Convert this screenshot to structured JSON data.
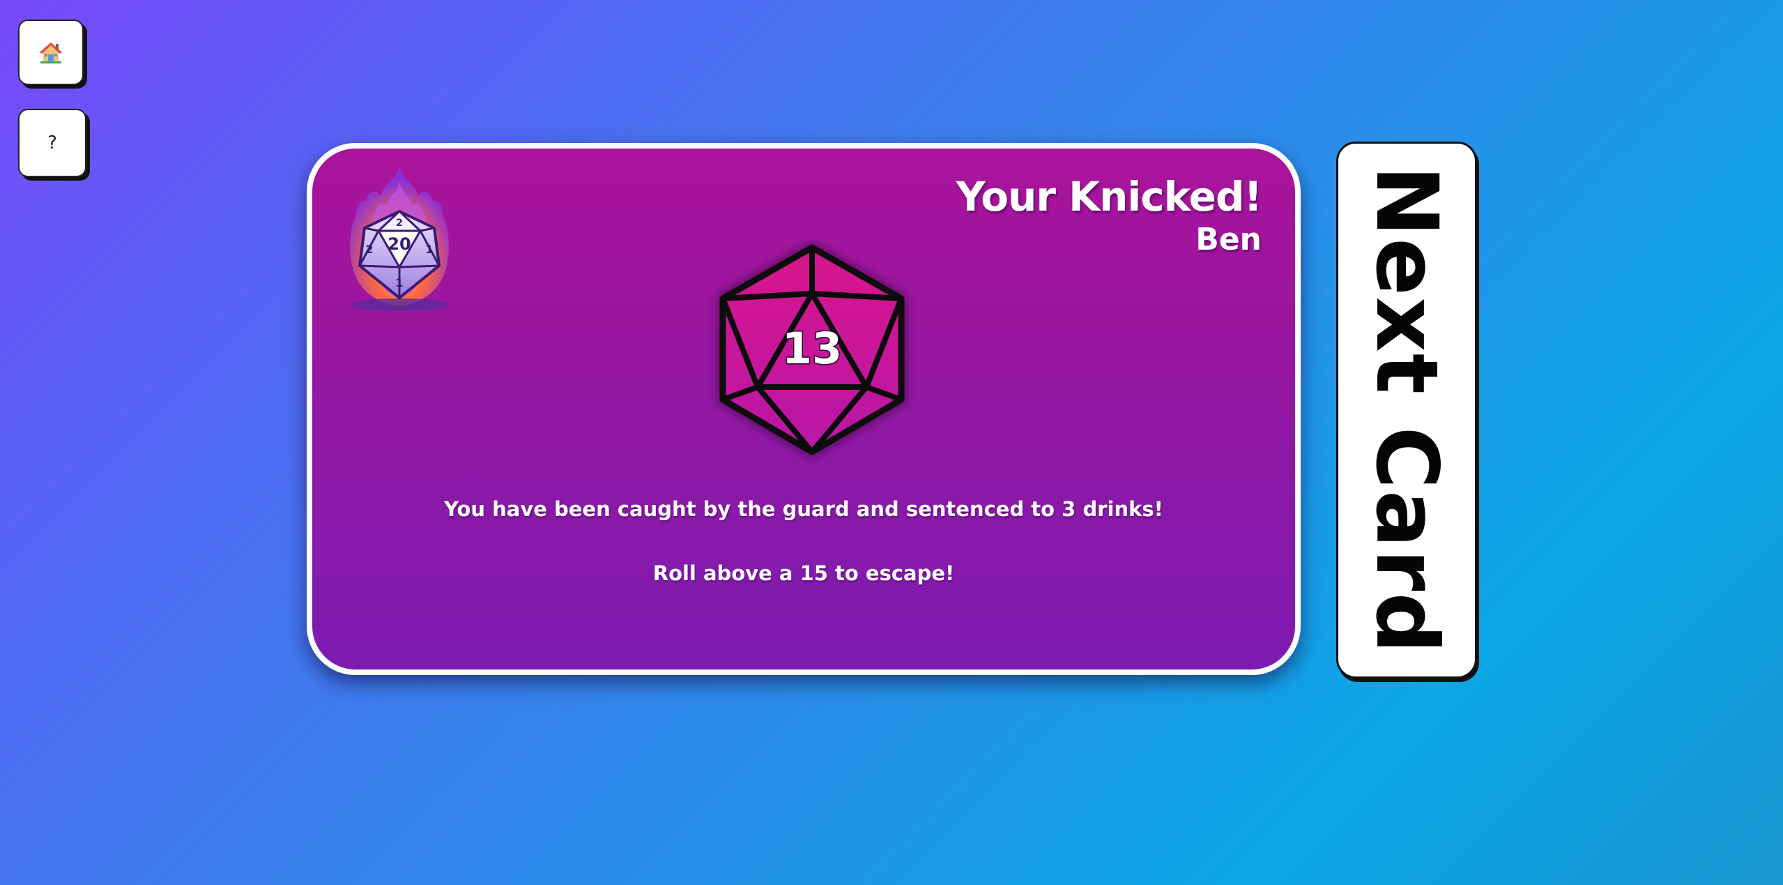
{
  "nav": {
    "home_icon": "house-icon",
    "help_label": "?"
  },
  "card": {
    "title": "Your Knicked!",
    "player": "Ben",
    "roll": "13",
    "logo": {
      "top_face": "2",
      "center_face": "20",
      "left_face": "2",
      "right_face": "1",
      "bottom_face": "1"
    },
    "text_primary": "You have been caught by the guard and sentenced to 3 drinks!",
    "text_secondary": "Roll above a 15 to escape!"
  },
  "next_button": {
    "label": "Next Card"
  },
  "colors": {
    "background_start": "#7749fa",
    "background_end": "#0ba6e6",
    "card_top": "#ab139b",
    "card_bottom": "#7d1bb1",
    "die_fill": "#d016a0",
    "accent_white": "#ffffff"
  }
}
